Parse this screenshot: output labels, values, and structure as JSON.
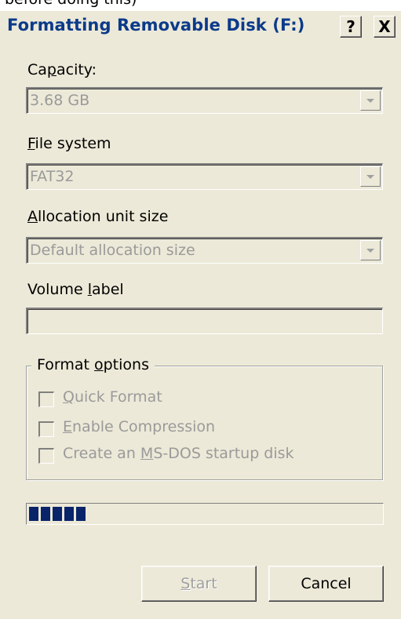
{
  "page_text": {
    "top": "before doing this)"
  },
  "window": {
    "title": "Formatting Removable Disk (F:)",
    "help_button": "?",
    "close_button": "X"
  },
  "capacity": {
    "label_pre": "Ca",
    "label_u": "p",
    "label_post": "acity:",
    "value": "3.68 GB"
  },
  "file_system": {
    "label_u": "F",
    "label_post": "ile system",
    "value": "FAT32"
  },
  "allocation": {
    "label_u": "A",
    "label_post": "llocation unit size",
    "value": "Default allocation size"
  },
  "volume_label": {
    "label_pre": "Volume ",
    "label_u": "l",
    "label_post": "abel",
    "value": ""
  },
  "format_options": {
    "title_pre": "Format ",
    "title_u": "o",
    "title_post": "ptions",
    "options": [
      {
        "pre": "",
        "u": "Q",
        "post": "uick Format",
        "checked": false
      },
      {
        "pre": "",
        "u": "E",
        "post": "nable Compression",
        "checked": false
      },
      {
        "pre": "Create an ",
        "u": "M",
        "post": "S-DOS startup disk",
        "checked": false
      }
    ]
  },
  "progress": {
    "fraction": 0.16
  },
  "buttons": {
    "start_u": "S",
    "start_post": "tart",
    "cancel": "Cancel"
  },
  "colors": {
    "title_text": "#0b3a8a",
    "progress_fill": "#0a246a",
    "dialog_bg": "#ece9d8"
  },
  "icons": {
    "dropdown": "chevron-down-icon"
  }
}
